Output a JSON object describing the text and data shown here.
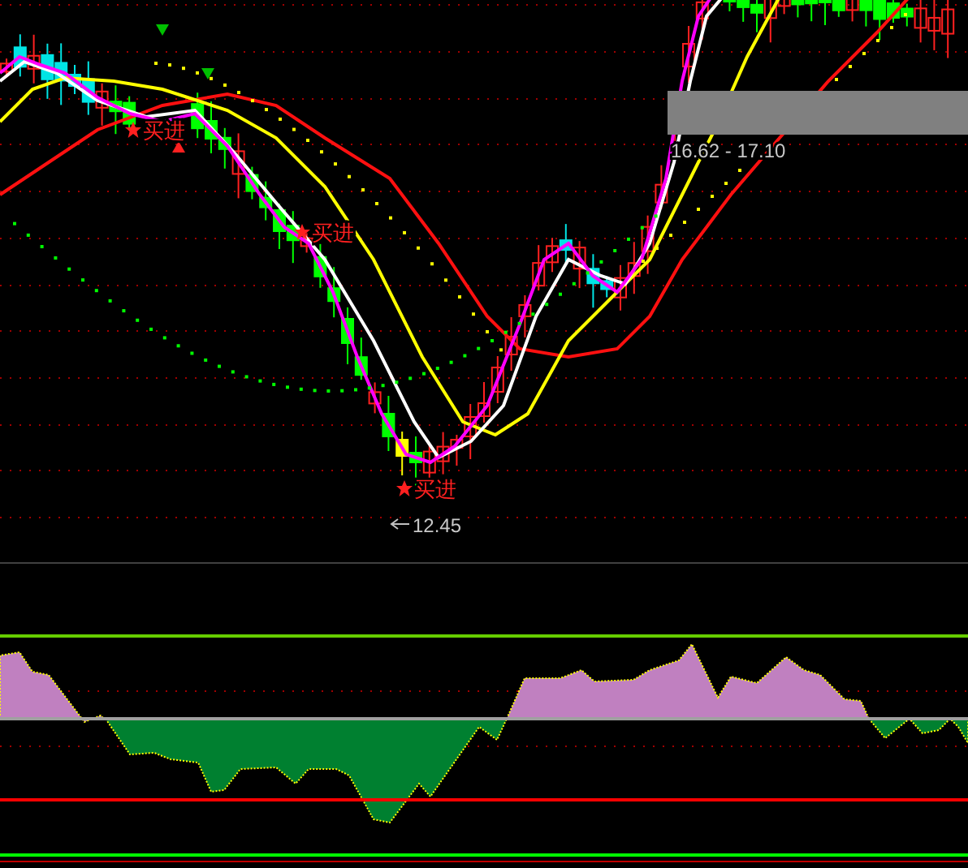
{
  "price_chart": {
    "buy_signals": [
      {
        "label": "买进"
      },
      {
        "label": "买进"
      },
      {
        "label": "买进"
      }
    ],
    "low_marker": {
      "price": "12.45"
    },
    "range_label": "16.62 - 17.10"
  }
}
